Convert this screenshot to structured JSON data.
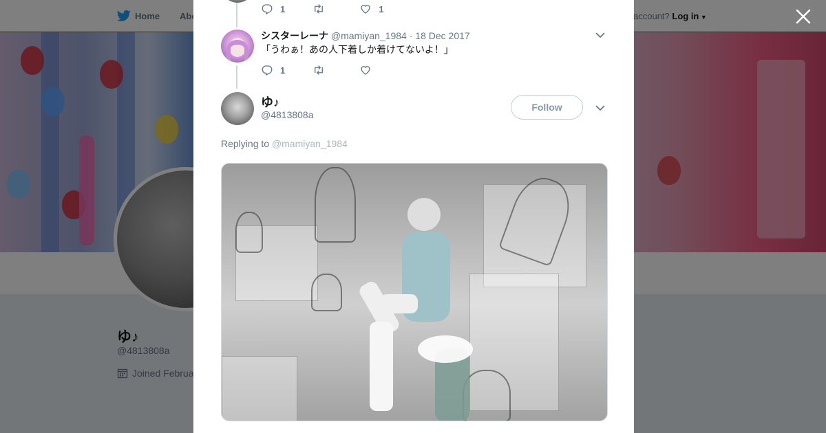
{
  "background_page": {
    "nav": {
      "home_label": "Home",
      "about_label": "Abo",
      "account_prompt": "account?",
      "login_label": "Log in"
    },
    "profile": {
      "name": "ゆ♪",
      "handle": "@4813808a",
      "joined_text": "Joined Februa"
    }
  },
  "modal": {
    "parent_tweet_actions": {
      "reply_count": "1",
      "retweet_count": "",
      "like_count": "1"
    },
    "reply_tweet": {
      "author_name": "シスターレーナ",
      "author_handle": "@mamiyan_1984",
      "separator": "·",
      "date": "18 Dec 2017",
      "text": "「うわぁ！あの人下着しか着けてないよ！」",
      "actions": {
        "reply_count": "1",
        "retweet_count": "",
        "like_count": ""
      }
    },
    "main_tweet": {
      "author_name": "ゆ♪",
      "author_handle": "@4813808a",
      "follow_label": "Follow",
      "replying_prefix": "Replying to",
      "replying_to": "@mamiyan_1984"
    }
  },
  "colors": {
    "accent": "#1da1f2",
    "text_primary": "#14171a",
    "text_secondary": "#657786",
    "muted": "#aab8c2"
  },
  "icons": [
    "twitter-bird-icon",
    "reply-icon",
    "retweet-icon",
    "heart-icon",
    "chevron-down-icon",
    "close-icon",
    "calendar-icon"
  ]
}
